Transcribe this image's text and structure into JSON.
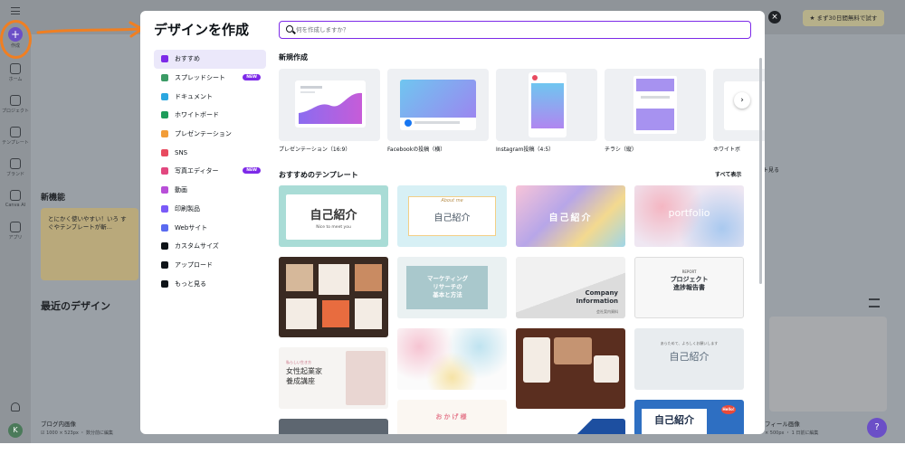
{
  "app": {
    "rail": {
      "create_label": "作成",
      "items": [
        {
          "label": "ホーム",
          "icon": "home-icon"
        },
        {
          "label": "プロジェクト",
          "icon": "folder-icon"
        },
        {
          "label": "テンプレート",
          "icon": "template-icon"
        },
        {
          "label": "ブランド",
          "icon": "brand-icon"
        },
        {
          "label": "Canva AI",
          "icon": "sparkle-icon"
        },
        {
          "label": "アプリ",
          "icon": "apps-icon"
        }
      ]
    },
    "trial_button": "★ まず30日間無料で試す",
    "new_features_heading": "新機能",
    "feature_card_text": "とにかく使いやすい！いろ すぐやテンプレートが斬...",
    "recent_heading": "最近のデザイン",
    "recent_items": [
      {
        "title": "ブログ内画像",
        "meta": "☑ 1000 × 523px ・ 数分前に編集"
      },
      {
        "title": "フィール画像",
        "meta": "× 500px ・ 1 日前に編集"
      }
    ],
    "see_more": "ト見る",
    "avatar_initial": "K",
    "help": "?"
  },
  "modal": {
    "title": "デザインを作成",
    "search_placeholder": "何を作成しますか？",
    "nav": [
      {
        "label": "おすすめ",
        "color": "#7d2ae8",
        "active": true,
        "badge": ""
      },
      {
        "label": "スプレッドシート",
        "color": "#3b9b65",
        "active": false,
        "badge": "NEW"
      },
      {
        "label": "ドキュメント",
        "color": "#2ba7e0",
        "active": false,
        "badge": ""
      },
      {
        "label": "ホワイトボード",
        "color": "#1d9c5a",
        "active": false,
        "badge": ""
      },
      {
        "label": "プレゼンテーション",
        "color": "#f29d38",
        "active": false,
        "badge": ""
      },
      {
        "label": "SNS",
        "color": "#e84a5f",
        "active": false,
        "badge": ""
      },
      {
        "label": "写真エディター",
        "color": "#e2477f",
        "active": false,
        "badge": "NEW"
      },
      {
        "label": "動画",
        "color": "#b84fd8",
        "active": false,
        "badge": ""
      },
      {
        "label": "印刷製品",
        "color": "#7a5af8",
        "active": false,
        "badge": ""
      },
      {
        "label": "Webサイト",
        "color": "#5a6af0",
        "active": false,
        "badge": ""
      },
      {
        "label": "カスタムサイズ",
        "color": "#0e1318",
        "active": false,
        "badge": ""
      },
      {
        "label": "アップロード",
        "color": "#0e1318",
        "active": false,
        "badge": ""
      },
      {
        "label": "もっと見る",
        "color": "#0e1318",
        "active": false,
        "badge": ""
      }
    ],
    "new_create_heading": "新規作成",
    "create_items": [
      {
        "label": "プレゼンテーション（16:9）"
      },
      {
        "label": "Facebookの投稿（横）"
      },
      {
        "label": "Instagram投稿（4:5）"
      },
      {
        "label": "チラシ（縦）"
      },
      {
        "label": "ホワイトボ"
      }
    ],
    "templates_heading": "おすすめのテンプレート",
    "see_all": "すべて表示",
    "templates": [
      {
        "text": "自己紹介",
        "sub": "Nice to meet you"
      },
      {
        "text": "自己紹介",
        "sub": "About me"
      },
      {
        "text": "自己紹介",
        "sub": ""
      },
      {
        "text": "portfolio",
        "sub": ""
      },
      {
        "text": "",
        "sub": ""
      },
      {
        "text": "マーケティング\nリサーチの\n基本と方法",
        "sub": ""
      },
      {
        "text": "Company\nInformation",
        "sub": "会社案内資料"
      },
      {
        "text": "プロジェクト\n進捗報告書",
        "sub": "REPORT"
      },
      {
        "text": "女性起業家\n養成講座",
        "sub": "私らしい生き方"
      },
      {
        "text": "",
        "sub": ""
      },
      {
        "text": "",
        "sub": ""
      },
      {
        "text": "自己紹介",
        "sub": "あらためて、よろしくお願いします"
      },
      {
        "text": "",
        "sub": ""
      },
      {
        "text": "おかげ様",
        "sub": ""
      },
      {
        "text": "",
        "sub": ""
      },
      {
        "text": "自己紹介",
        "sub": "Hello!"
      }
    ],
    "close": "×"
  }
}
